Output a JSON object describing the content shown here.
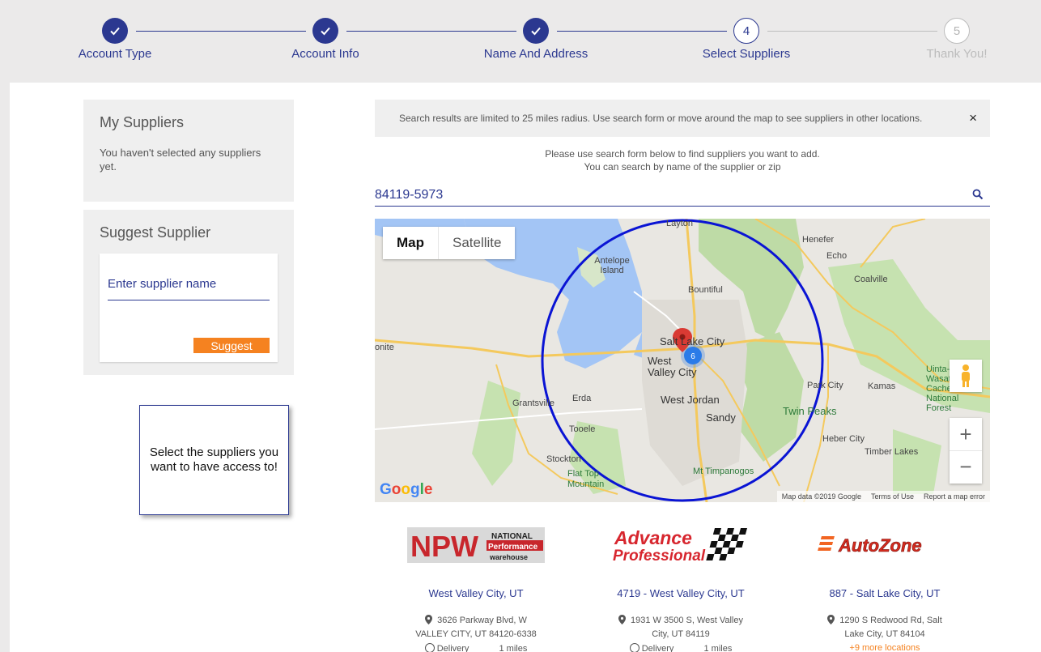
{
  "steps": [
    {
      "label": "Account Type",
      "state": "done",
      "number": "1"
    },
    {
      "label": "Account Info",
      "state": "done",
      "number": "2"
    },
    {
      "label": "Name And Address",
      "state": "done",
      "number": "3"
    },
    {
      "label": "Select Suppliers",
      "state": "current",
      "number": "4"
    },
    {
      "label": "Thank You!",
      "state": "future",
      "number": "5"
    }
  ],
  "my_suppliers": {
    "title": "My Suppliers",
    "empty_text": "You haven't selected any suppliers yet."
  },
  "suggest_supplier": {
    "title": "Suggest Supplier",
    "placeholder": "Enter supplier name",
    "button_label": "Suggest"
  },
  "tooltip": {
    "text": "Select the suppliers you want to have access to!"
  },
  "info_bar": {
    "text": "Search results are limited to 25 miles radius. Use search form or move around the map to see suppliers in other locations.",
    "close": "×"
  },
  "search": {
    "help_line1": "Please use search form below to find suppliers you want to add.",
    "help_line2": "You can search by name of the supplier or zip",
    "value": "84119-5973"
  },
  "map": {
    "tab_map": "Map",
    "tab_satellite": "Satellite",
    "cluster_count": "6",
    "attribution": "Map data ©2019 Google",
    "terms": "Terms of Use",
    "report": "Report a map error",
    "zoom_in": "+",
    "zoom_out": "−",
    "places": [
      "Layton",
      "Henefer",
      "Echo",
      "Antelope Island",
      "Bountiful",
      "Coalville",
      "Salt Lake City",
      "West Valley City",
      "onite",
      "Grantsville",
      "Erda",
      "West Jordan",
      "Park City",
      "Kamas",
      "Uinta-Wasatch-Cache National Forest",
      "Sandy",
      "Twin Peaks",
      "Tooele",
      "Heber City",
      "Timber Lakes",
      "Stockton",
      "Flat Top Mountain",
      "Mt Timpanogos"
    ],
    "highways": [
      "84",
      "89",
      "15",
      "80",
      "65",
      "215",
      "80",
      "138",
      "154",
      "190",
      "248",
      "150",
      "196",
      "36",
      "15",
      "189",
      "40",
      "92",
      "73",
      "15"
    ]
  },
  "suppliers": [
    {
      "logo": "NPW National Performance Warehouse",
      "name": "West Valley City, UT",
      "address_line1": "3626 Parkway Blvd, W",
      "address_line2": "VALLEY CITY, UT 84120-6338",
      "delivery": "Delivery",
      "distance": "1 miles"
    },
    {
      "logo": "Advance Professional",
      "name": "4719 - West Valley City, UT",
      "address_line1": "1931 W 3500 S, West Valley",
      "address_line2": "City, UT 84119",
      "delivery": "Delivery",
      "distance": "1 miles"
    },
    {
      "logo": "AutoZone",
      "name": "887 - Salt Lake City, UT",
      "address_line1": "1290 S Redwood Rd, Salt",
      "address_line2": "Lake City, UT 84104",
      "more": "+9 more locations"
    }
  ],
  "colors": {
    "brand_blue": "#2b3890",
    "accent_orange": "#f58220",
    "radius_circle": "#0a14d4"
  }
}
